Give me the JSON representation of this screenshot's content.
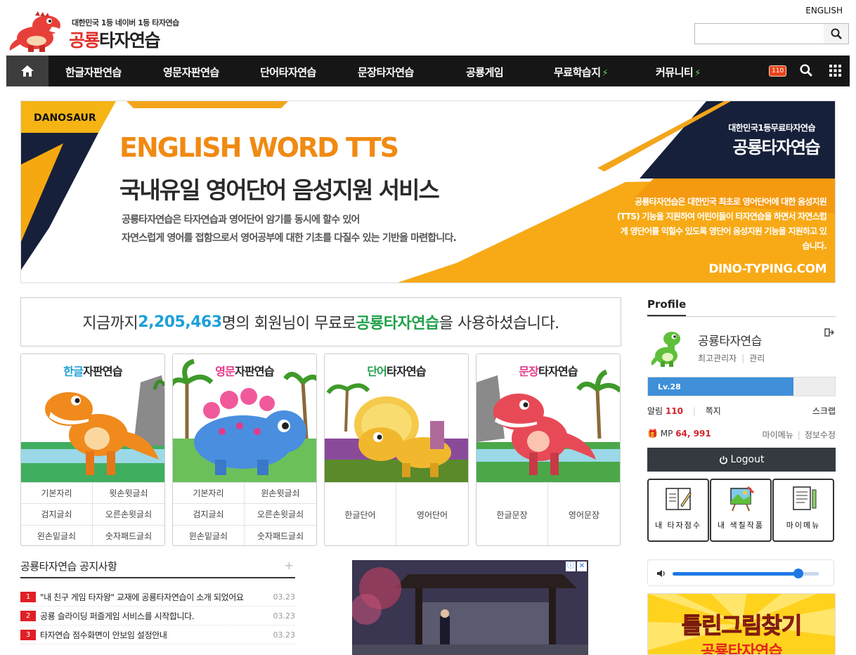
{
  "header": {
    "tagline": "대한민국 1등 네이버 1등 타자연습",
    "brand_red": "공룡",
    "brand_rest": "타자연습",
    "lang": "ENGLISH",
    "search_placeholder": ""
  },
  "nav": {
    "items": [
      "한글자판연습",
      "영문자판연습",
      "단어타자연습",
      "문장타자연습",
      "공룡게임",
      "무료학습지",
      "커뮤니티"
    ],
    "badge": "110"
  },
  "banner": {
    "brand": "DANOSAUR",
    "title": "ENGLISH WORD TTS",
    "subtitle": "국내유일 영어단어 음성지원 서비스",
    "desc1": "공룡타자연습은 타자연습과 영어단어 암기를 동시에 할수 있어",
    "desc2": "자연스럽게 영어를 접함으로서 영어공부에 대한 기초를 다질수 있는 기반을 마련합니다.",
    "right_top": "대한민국1등무료타자연습",
    "right_name": "공룡타자연습",
    "right_desc": "공룡타자연습은 대한민국 최초로 영어단어에 대한 음성지원(TTS) 기능을 지원하여 어린이들이 타자연습을 하면서 자연스럽게 영단어를 익힐수 있도록 영단어 음성지원 기능을 지원하고 있습니다.",
    "url": "DINO-TYPING.COM"
  },
  "member": {
    "prefix": "지금까지 ",
    "count": "2,205,463",
    "middle": "명의 회원님이 무료로 ",
    "brand": "공룡타자연습",
    "suffix": "을 사용하셨습니다."
  },
  "cards": [
    {
      "hl": "한글",
      "rest": "자판연습",
      "items": [
        "기본자리",
        "윗손윗글쇠",
        "검지글쇠",
        "오른손윗글쇠",
        "왼손밑글쇠",
        "숫자패드글쇠"
      ]
    },
    {
      "hl": "영문",
      "rest": "자판연습",
      "items": [
        "기본자리",
        "윈손윗글쇠",
        "검지글쇠",
        "오른손윗글쇠",
        "윈손밑글쇠",
        "숫자패드글쇠"
      ]
    },
    {
      "hl": "단어",
      "rest": "타자연습",
      "items": [
        "한글단어",
        "영어단어"
      ]
    },
    {
      "hl": "문장",
      "rest": "타자연습",
      "items": [
        "한글문장",
        "영어문장"
      ]
    }
  ],
  "notice": {
    "title": "공룡타자연습 공지사항",
    "plus": "+",
    "rows": [
      {
        "num": "1",
        "text": "\"내 친구 게임 타자왕\" 교재에 공룡타자연습이 소개 되었어요",
        "date": "03.23"
      },
      {
        "num": "2",
        "text": "공룡 슬라이딩 퍼즐게임 서비스를 시작합니다.",
        "date": "03.23"
      },
      {
        "num": "3",
        "text": "타자연습 점수화면이 안보임 설정안내",
        "date": "03.23"
      }
    ]
  },
  "ad": {
    "info": "ⓘ",
    "close": "✕"
  },
  "profile": {
    "head": "Profile",
    "name": "공룡타자연습",
    "role": "최고관리자",
    "manage": "관리",
    "level": "Lv.28",
    "level_progress": 0.78,
    "alarm_label": "알림",
    "alarm_count": "110",
    "note": "쪽지",
    "scrap": "스크랩",
    "mp_label": "MP",
    "mp_value": "64, 991",
    "mymenu": "마이메뉴",
    "edit": "정보수정",
    "logout": "Logout",
    "tiles": [
      "내 타자점수",
      "내 색칠작품",
      "마이메뉴"
    ]
  },
  "audio": {
    "volume": 0.86
  },
  "promo": {
    "text": "틀린그림찾기",
    "sub": "공룡타자연습"
  }
}
